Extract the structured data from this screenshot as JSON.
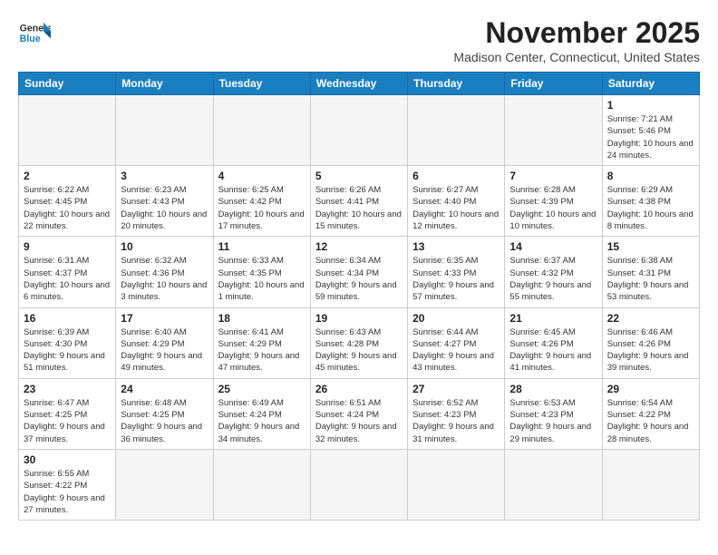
{
  "header": {
    "logo_text_general": "General",
    "logo_text_blue": "Blue",
    "month": "November 2025",
    "location": "Madison Center, Connecticut, United States"
  },
  "weekdays": [
    "Sunday",
    "Monday",
    "Tuesday",
    "Wednesday",
    "Thursday",
    "Friday",
    "Saturday"
  ],
  "weeks": [
    [
      {
        "day": "",
        "info": ""
      },
      {
        "day": "",
        "info": ""
      },
      {
        "day": "",
        "info": ""
      },
      {
        "day": "",
        "info": ""
      },
      {
        "day": "",
        "info": ""
      },
      {
        "day": "",
        "info": ""
      },
      {
        "day": "1",
        "info": "Sunrise: 7:21 AM\nSunset: 5:46 PM\nDaylight: 10 hours and 24 minutes."
      }
    ],
    [
      {
        "day": "2",
        "info": "Sunrise: 6:22 AM\nSunset: 4:45 PM\nDaylight: 10 hours and 22 minutes."
      },
      {
        "day": "3",
        "info": "Sunrise: 6:23 AM\nSunset: 4:43 PM\nDaylight: 10 hours and 20 minutes."
      },
      {
        "day": "4",
        "info": "Sunrise: 6:25 AM\nSunset: 4:42 PM\nDaylight: 10 hours and 17 minutes."
      },
      {
        "day": "5",
        "info": "Sunrise: 6:26 AM\nSunset: 4:41 PM\nDaylight: 10 hours and 15 minutes."
      },
      {
        "day": "6",
        "info": "Sunrise: 6:27 AM\nSunset: 4:40 PM\nDaylight: 10 hours and 12 minutes."
      },
      {
        "day": "7",
        "info": "Sunrise: 6:28 AM\nSunset: 4:39 PM\nDaylight: 10 hours and 10 minutes."
      },
      {
        "day": "8",
        "info": "Sunrise: 6:29 AM\nSunset: 4:38 PM\nDaylight: 10 hours and 8 minutes."
      }
    ],
    [
      {
        "day": "9",
        "info": "Sunrise: 6:31 AM\nSunset: 4:37 PM\nDaylight: 10 hours and 6 minutes."
      },
      {
        "day": "10",
        "info": "Sunrise: 6:32 AM\nSunset: 4:36 PM\nDaylight: 10 hours and 3 minutes."
      },
      {
        "day": "11",
        "info": "Sunrise: 6:33 AM\nSunset: 4:35 PM\nDaylight: 10 hours and 1 minute."
      },
      {
        "day": "12",
        "info": "Sunrise: 6:34 AM\nSunset: 4:34 PM\nDaylight: 9 hours and 59 minutes."
      },
      {
        "day": "13",
        "info": "Sunrise: 6:35 AM\nSunset: 4:33 PM\nDaylight: 9 hours and 57 minutes."
      },
      {
        "day": "14",
        "info": "Sunrise: 6:37 AM\nSunset: 4:32 PM\nDaylight: 9 hours and 55 minutes."
      },
      {
        "day": "15",
        "info": "Sunrise: 6:38 AM\nSunset: 4:31 PM\nDaylight: 9 hours and 53 minutes."
      }
    ],
    [
      {
        "day": "16",
        "info": "Sunrise: 6:39 AM\nSunset: 4:30 PM\nDaylight: 9 hours and 51 minutes."
      },
      {
        "day": "17",
        "info": "Sunrise: 6:40 AM\nSunset: 4:29 PM\nDaylight: 9 hours and 49 minutes."
      },
      {
        "day": "18",
        "info": "Sunrise: 6:41 AM\nSunset: 4:29 PM\nDaylight: 9 hours and 47 minutes."
      },
      {
        "day": "19",
        "info": "Sunrise: 6:43 AM\nSunset: 4:28 PM\nDaylight: 9 hours and 45 minutes."
      },
      {
        "day": "20",
        "info": "Sunrise: 6:44 AM\nSunset: 4:27 PM\nDaylight: 9 hours and 43 minutes."
      },
      {
        "day": "21",
        "info": "Sunrise: 6:45 AM\nSunset: 4:26 PM\nDaylight: 9 hours and 41 minutes."
      },
      {
        "day": "22",
        "info": "Sunrise: 6:46 AM\nSunset: 4:26 PM\nDaylight: 9 hours and 39 minutes."
      }
    ],
    [
      {
        "day": "23",
        "info": "Sunrise: 6:47 AM\nSunset: 4:25 PM\nDaylight: 9 hours and 37 minutes."
      },
      {
        "day": "24",
        "info": "Sunrise: 6:48 AM\nSunset: 4:25 PM\nDaylight: 9 hours and 36 minutes."
      },
      {
        "day": "25",
        "info": "Sunrise: 6:49 AM\nSunset: 4:24 PM\nDaylight: 9 hours and 34 minutes."
      },
      {
        "day": "26",
        "info": "Sunrise: 6:51 AM\nSunset: 4:24 PM\nDaylight: 9 hours and 32 minutes."
      },
      {
        "day": "27",
        "info": "Sunrise: 6:52 AM\nSunset: 4:23 PM\nDaylight: 9 hours and 31 minutes."
      },
      {
        "day": "28",
        "info": "Sunrise: 6:53 AM\nSunset: 4:23 PM\nDaylight: 9 hours and 29 minutes."
      },
      {
        "day": "29",
        "info": "Sunrise: 6:54 AM\nSunset: 4:22 PM\nDaylight: 9 hours and 28 minutes."
      }
    ],
    [
      {
        "day": "30",
        "info": "Sunrise: 6:55 AM\nSunset: 4:22 PM\nDaylight: 9 hours and 27 minutes."
      },
      {
        "day": "",
        "info": ""
      },
      {
        "day": "",
        "info": ""
      },
      {
        "day": "",
        "info": ""
      },
      {
        "day": "",
        "info": ""
      },
      {
        "day": "",
        "info": ""
      },
      {
        "day": "",
        "info": ""
      }
    ]
  ]
}
